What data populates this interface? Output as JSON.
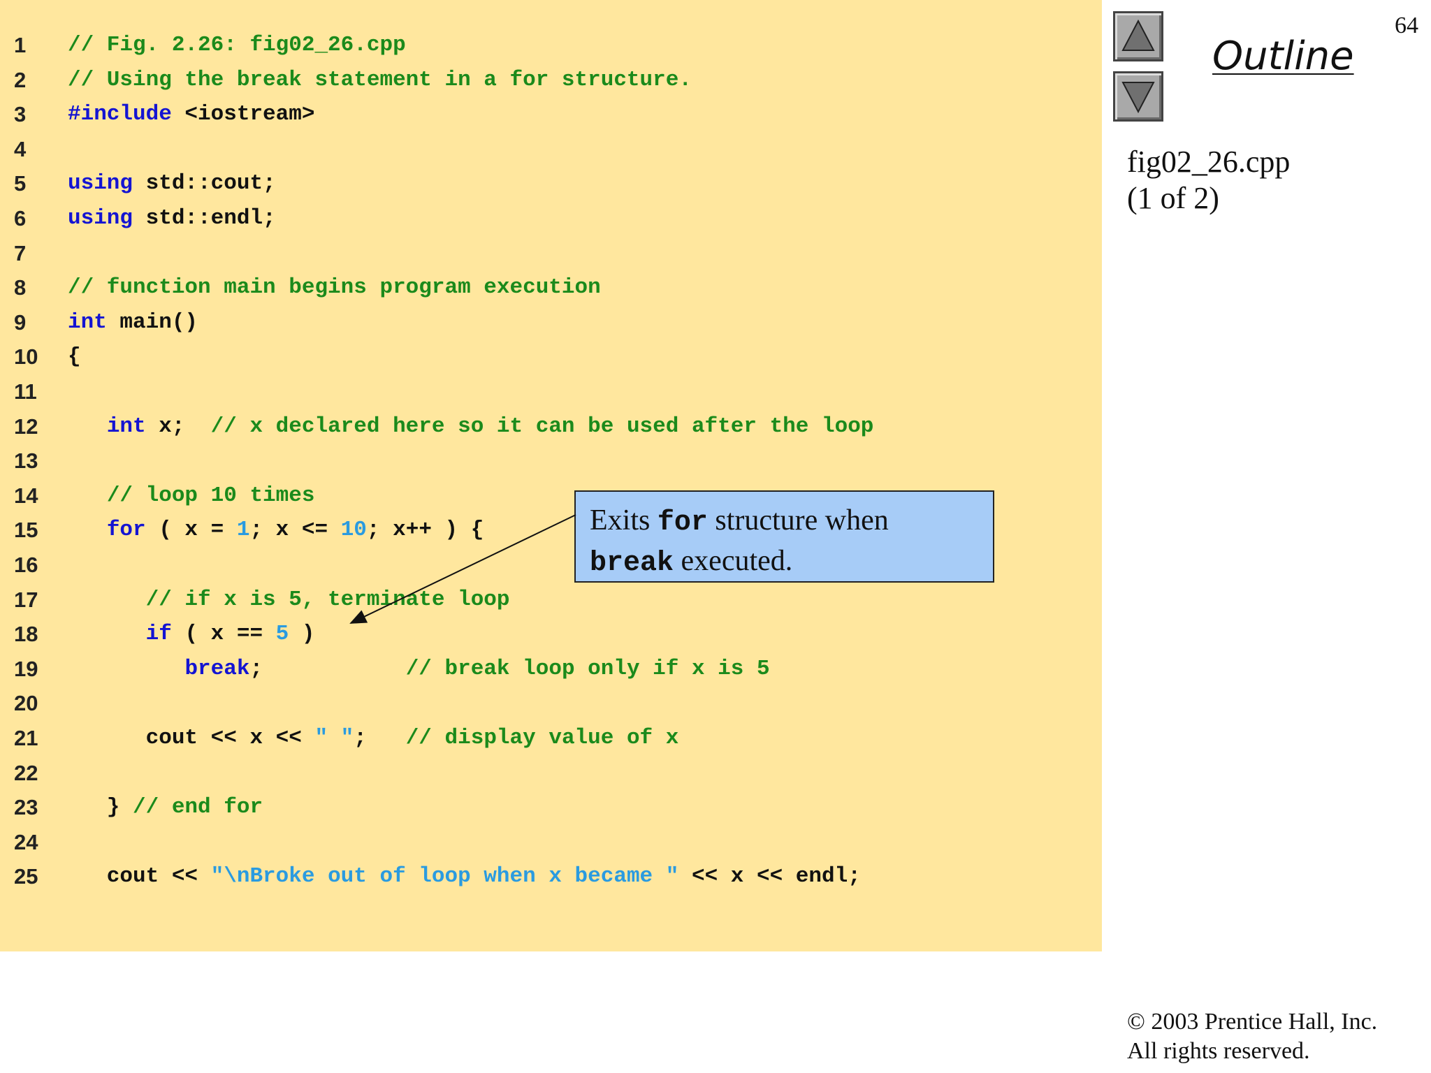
{
  "slide": {
    "page_number": "64",
    "outline_title": "Outline",
    "file_name": "fig02_26.cpp",
    "file_part": "(1 of 2)",
    "copyright": "© 2003 Prentice Hall, Inc.",
    "rights": "All rights reserved."
  },
  "nav": {
    "up_icon": "triangle-up-icon",
    "down_icon": "triangle-down-icon"
  },
  "callout": {
    "t1": "Exits ",
    "t2": "for",
    "t3": " structure when",
    "t4": "break",
    "t5": " executed."
  },
  "colors": {
    "panel_bg": "#ffe79e",
    "comment": "#1b8a1b",
    "keyword": "#1414d2",
    "number": "#2a9be0",
    "string": "#2a9be0",
    "callout_bg": "#a7ccf7"
  },
  "code": [
    {
      "num": "1",
      "tokens": [
        {
          "t": "comment",
          "v": "// Fig. 2.26: fig02_26.cpp"
        }
      ]
    },
    {
      "num": "2",
      "tokens": [
        {
          "t": "comment",
          "v": "// Using the break statement in a for structure."
        }
      ]
    },
    {
      "num": "3",
      "tokens": [
        {
          "t": "keyword",
          "v": "#include"
        },
        {
          "t": "plain",
          "v": " <iostream>"
        }
      ]
    },
    {
      "num": "4",
      "tokens": []
    },
    {
      "num": "5",
      "tokens": [
        {
          "t": "keyword",
          "v": "using"
        },
        {
          "t": "plain",
          "v": " std::cout;"
        }
      ]
    },
    {
      "num": "6",
      "tokens": [
        {
          "t": "keyword",
          "v": "using"
        },
        {
          "t": "plain",
          "v": " std::endl;"
        }
      ]
    },
    {
      "num": "7",
      "tokens": []
    },
    {
      "num": "8",
      "tokens": [
        {
          "t": "comment",
          "v": "// function main begins program execution"
        }
      ]
    },
    {
      "num": "9",
      "tokens": [
        {
          "t": "keyword",
          "v": "int"
        },
        {
          "t": "plain",
          "v": " main()"
        }
      ]
    },
    {
      "num": "10",
      "tokens": [
        {
          "t": "plain",
          "v": "{"
        }
      ]
    },
    {
      "num": "11",
      "tokens": []
    },
    {
      "num": "12",
      "tokens": [
        {
          "t": "plain",
          "v": "   "
        },
        {
          "t": "keyword",
          "v": "int"
        },
        {
          "t": "plain",
          "v": " x;  "
        },
        {
          "t": "comment",
          "v": "// x declared here so it can be used after the loop"
        }
      ]
    },
    {
      "num": "13",
      "tokens": []
    },
    {
      "num": "14",
      "tokens": [
        {
          "t": "plain",
          "v": "   "
        },
        {
          "t": "comment",
          "v": "// loop 10 times"
        }
      ]
    },
    {
      "num": "15",
      "tokens": [
        {
          "t": "plain",
          "v": "   "
        },
        {
          "t": "keyword",
          "v": "for"
        },
        {
          "t": "plain",
          "v": " ( x = "
        },
        {
          "t": "number",
          "v": "1"
        },
        {
          "t": "plain",
          "v": "; x <= "
        },
        {
          "t": "number",
          "v": "10"
        },
        {
          "t": "plain",
          "v": "; x++ ) {"
        }
      ]
    },
    {
      "num": "16",
      "tokens": []
    },
    {
      "num": "17",
      "tokens": [
        {
          "t": "plain",
          "v": "      "
        },
        {
          "t": "comment",
          "v": "// if x is 5, terminate loop"
        }
      ]
    },
    {
      "num": "18",
      "tokens": [
        {
          "t": "plain",
          "v": "      "
        },
        {
          "t": "keyword",
          "v": "if"
        },
        {
          "t": "plain",
          "v": " ( x == "
        },
        {
          "t": "number",
          "v": "5"
        },
        {
          "t": "plain",
          "v": " )"
        }
      ]
    },
    {
      "num": "19",
      "tokens": [
        {
          "t": "plain",
          "v": "         "
        },
        {
          "t": "keyword",
          "v": "break"
        },
        {
          "t": "plain",
          "v": ";           "
        },
        {
          "t": "comment",
          "v": "// break loop only if x is 5"
        }
      ]
    },
    {
      "num": "20",
      "tokens": []
    },
    {
      "num": "21",
      "tokens": [
        {
          "t": "plain",
          "v": "      cout << x << "
        },
        {
          "t": "string",
          "v": "\" \""
        },
        {
          "t": "plain",
          "v": ";   "
        },
        {
          "t": "comment",
          "v": "// display value of x"
        }
      ]
    },
    {
      "num": "22",
      "tokens": []
    },
    {
      "num": "23",
      "tokens": [
        {
          "t": "plain",
          "v": "   } "
        },
        {
          "t": "comment",
          "v": "// end for"
        }
      ]
    },
    {
      "num": "24",
      "tokens": []
    },
    {
      "num": "25",
      "tokens": [
        {
          "t": "plain",
          "v": "   cout << "
        },
        {
          "t": "string",
          "v": "\"\\nBroke out of loop when x became \""
        },
        {
          "t": "plain",
          "v": " << x << endl;"
        }
      ]
    }
  ]
}
